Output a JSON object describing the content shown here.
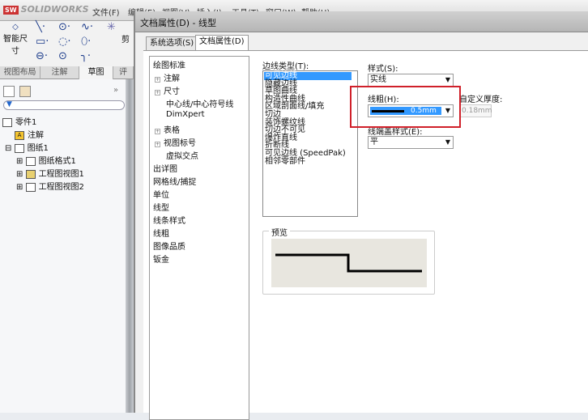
{
  "app": {
    "logo_text": "SOLIDWORKS",
    "logo_badge": "SW"
  },
  "menu": [
    "文件(F)",
    "编辑(E)",
    "视图(V)",
    "插入(I)",
    "工具(T)",
    "窗口(W)",
    "帮助(H)"
  ],
  "toolbar": {
    "smart_dim": "智能尺寸",
    "trim": "剪"
  },
  "fm_tabs": [
    "视图布局",
    "注解",
    "草图",
    "评"
  ],
  "feature_tree": {
    "root": "零件1",
    "items": [
      "注解",
      "图纸1",
      "图纸格式1",
      "工程图视图1",
      "工程图视图2"
    ],
    "more": "»"
  },
  "dialog": {
    "title": "文档属性(D) - 线型",
    "tabs": [
      "系统选项(S)",
      "文档属性(D)"
    ],
    "tree": [
      "绘图标准",
      "注解",
      "尺寸",
      "中心线/中心符号线",
      "DimXpert",
      "表格",
      "视图标号",
      "虚拟交点",
      "出详图",
      "网格线/捕捉",
      "单位",
      "线型",
      "线条样式",
      "线粗",
      "图像品质",
      "钣金"
    ],
    "line_type_label": "边线类型(T):",
    "line_types": [
      "可见边线",
      "隐藏边线",
      "草图曲线",
      "构造性曲线",
      "区域剖面线/填充",
      "切边",
      "装饰螺纹线",
      "切边不可见",
      "爆炸直线",
      "折断线",
      "可见边线 (SpeedPak)",
      "相邻零部件"
    ],
    "style_label": "样式(S):",
    "style_value": "实线",
    "thickness_label": "线粗(H):",
    "thickness_value": "0.5mm",
    "custom_label": "自定义厚度:",
    "custom_value": "0.18mm",
    "end_cap_label": "线端盖样式(E):",
    "end_cap_value": "平",
    "preview_label": "预览"
  },
  "colors": {
    "highlight": "#3399ff",
    "annotation": "#d0202a"
  }
}
